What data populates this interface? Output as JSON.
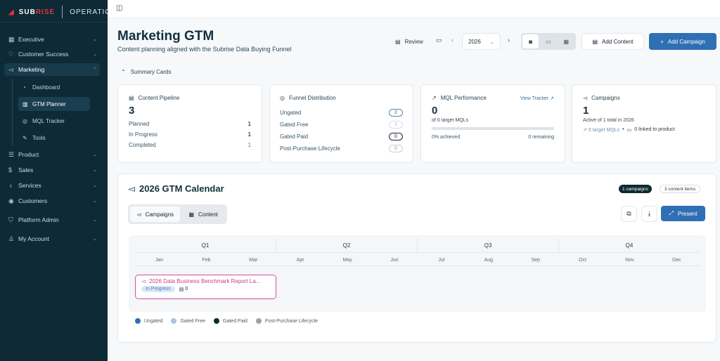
{
  "brand": {
    "logo_text_a": "SUB",
    "logo_text_b": "RISE",
    "product": "OPERATIONS"
  },
  "sidebar": {
    "items": [
      {
        "label": "Executive",
        "icon": "grid-icon"
      },
      {
        "label": "Customer Success",
        "icon": "heart-icon"
      },
      {
        "label": "Marketing",
        "icon": "megaphone-icon",
        "expanded": true
      },
      {
        "label": "Product",
        "icon": "layers-icon"
      },
      {
        "label": "Sales",
        "icon": "dollar-icon"
      },
      {
        "label": "Services",
        "icon": "lightbulb-icon"
      },
      {
        "label": "Customers",
        "icon": "users-icon"
      },
      {
        "label": "Platform Admin",
        "icon": "shield-icon"
      },
      {
        "label": "My Account",
        "icon": "user-icon"
      }
    ],
    "sub_items": [
      {
        "label": "Dashboard"
      },
      {
        "label": "GTM Planner",
        "active": true
      },
      {
        "label": "MQL Tracker"
      },
      {
        "label": "Tools"
      }
    ]
  },
  "header": {
    "title": "Marketing GTM",
    "subtitle": "Content planning aligned with the Subrise Data Buying Funnel",
    "review": "Review",
    "year": "2026",
    "add_content": "Add Content",
    "add_campaign": "Add Campaign"
  },
  "summary": {
    "toggle": "Summary Cards",
    "pipeline": {
      "title": "Content Pipeline",
      "total": "3",
      "rows": [
        {
          "label": "Planned",
          "value": "1"
        },
        {
          "label": "In Progress",
          "value": "1"
        },
        {
          "label": "Completed",
          "value": "1"
        }
      ]
    },
    "funnel": {
      "title": "Funnel Distribution",
      "rows": [
        {
          "label": "Ungated",
          "value": "2"
        },
        {
          "label": "Gated Free",
          "value": "1"
        },
        {
          "label": "Gated Paid",
          "value": "0"
        },
        {
          "label": "Post-Purchase Lifecycle",
          "value": "0"
        }
      ]
    },
    "mql": {
      "title": "MQL Performance",
      "link": "View Tracker",
      "value": "0",
      "target": "of 0 target MQLs",
      "progress": 0,
      "achieved": "0% achieved",
      "remaining": "0 remaining"
    },
    "campaigns": {
      "title": "Campaigns",
      "value": "1",
      "sub": "Active of 1 total in 2026",
      "target": "0 target MQLs",
      "linked": "0 linked to product"
    }
  },
  "calendar": {
    "title": "2026 GTM Calendar",
    "badge_campaigns": "1 campaigns",
    "badge_content": "3 content items",
    "tab_campaigns": "Campaigns",
    "tab_content": "Content",
    "present": "Present",
    "quarters": [
      "Q1",
      "Q2",
      "Q3",
      "Q4"
    ],
    "months": [
      "Jan",
      "Feb",
      "Mar",
      "Apr",
      "May",
      "Jun",
      "Jul",
      "Aug",
      "Sep",
      "Oct",
      "Nov",
      "Dec"
    ],
    "campaign": {
      "title": "2026 Data Business Benchmark Report La...",
      "status": "In Progress",
      "content_count": "0"
    },
    "legend": [
      {
        "label": "Ungated",
        "color": "#2e6fb5"
      },
      {
        "label": "Gated Free",
        "color": "#a9c3e0"
      },
      {
        "label": "Gated Paid",
        "color": "#0d2a30"
      },
      {
        "label": "Post-Purchase Lifecycle",
        "color": "#9aa3ad"
      }
    ]
  },
  "colors": {
    "sidebar": "#0d2a36",
    "primary": "#2f6fb3",
    "campaign": "#d64d95"
  }
}
